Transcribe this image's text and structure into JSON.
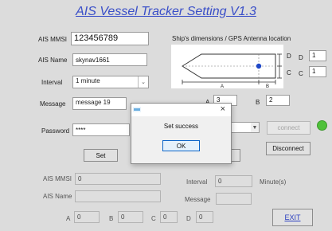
{
  "title": "AIS Vessel Tracker Setting  V1.3",
  "settings": {
    "mmsi_label": "AIS MMSI",
    "mmsi_value": "123456789",
    "name_label": "AIS  Name",
    "name_value": "skynav1661",
    "interval_label": "Interval",
    "interval_value": "1 minute",
    "message_label": "Message",
    "message_value": "message 19",
    "password_label": "Password",
    "password_value": "****",
    "set_button": "Set"
  },
  "dimensions": {
    "heading": "Ship's dimensions / GPS Antenna location",
    "D_label": "D",
    "D_value": "1",
    "C_label": "C",
    "C_value": "1",
    "A_label": "A",
    "A_value": "3",
    "B_label": "B",
    "B_value": "2",
    "diagram_A": "A",
    "diagram_B": "B",
    "diagram_C": "C",
    "diagram_D": "D"
  },
  "connection": {
    "connect_button": "connect",
    "disconnect_button": "Disconnect",
    "status_color": "#4fc13a"
  },
  "readback": {
    "mmsi_label": "AIS MMSI",
    "mmsi_value": "0",
    "name_label": "AIS Name",
    "name_value": "",
    "interval_label": "Interval",
    "interval_value": "0",
    "interval_unit": "Minute(s)",
    "message_label": "Message",
    "message_value": "",
    "A_label": "A",
    "A_value": "0",
    "B_label": "B",
    "B_value": "0",
    "C_label": "C",
    "C_value": "0",
    "D_label": "D",
    "D_value": "0"
  },
  "exit_button": "EXIT",
  "dialog": {
    "message": "Set success",
    "ok_button": "OK",
    "close_glyph": "×"
  }
}
